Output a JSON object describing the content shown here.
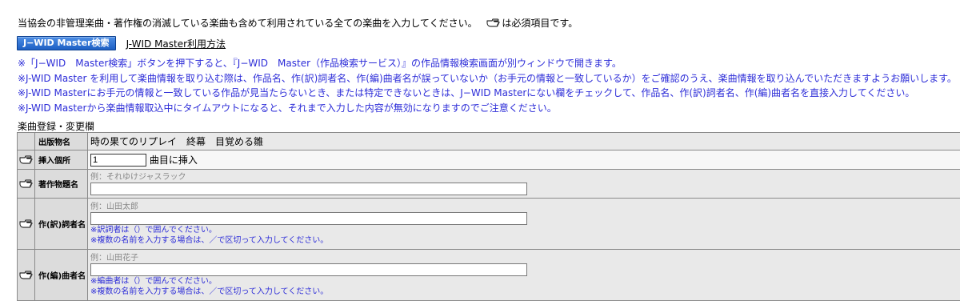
{
  "intro": {
    "text_before": "当協会の非管理楽曲・著作権の消滅している楽曲も含めて利用されている全ての楽曲を入力してください。",
    "required_note": "は必須項目です。",
    "required_icon": "pointing-hand-icon"
  },
  "toolbar": {
    "jwid_button": "J−WID Master検索",
    "jwid_link": "J-WID Master利用方法"
  },
  "notes": [
    "※「J−WID　Master検索」ボタンを押下すると、『J−WID　Master（作品検索サービス）』の作品情報検索画面が別ウィンドウで開きます。",
    "※J-WID Master を利用して楽曲情報を取り込む際は、作品名、作(訳)詞者名、作(編)曲者名が誤っていないか（お手元の情報と一致しているか）をご確認のうえ、楽曲情報を取り込んでいただきますようお願いします。",
    "※J-WID Masterにお手元の情報と一致している作品が見当たらないとき、または特定できないときは、J−WID Masterにない欄をチェックして、作品名、作(訳)詞者名、作(編)曲者名を直接入力してください。",
    "※J-WID Masterから楽曲情報取込中にタイムアウトになると、それまで入力した内容が無効になりますのでご注意ください。"
  ],
  "section_title": "楽曲登録・変更欄",
  "form": {
    "publication": {
      "label": "出版物名",
      "value": "時の果てのリプレイ　終幕　目覚める雛"
    },
    "insert_position": {
      "label": "挿入個所",
      "value": "1",
      "suffix": "曲目に挿入"
    },
    "work_title": {
      "label": "著作物題名",
      "placeholder": "例：それゆけジャスラック",
      "value": ""
    },
    "lyricist": {
      "label": "作(訳)詞者名",
      "placeholder": "例：山田太郎",
      "value": "",
      "notes": [
        "※訳詞者は（）で囲んでください。",
        "※複数の名前を入力する場合は、／で区切って入力してください。"
      ]
    },
    "composer": {
      "label": "作(編)曲者名",
      "placeholder": "例：山田花子",
      "value": "",
      "notes": [
        "※編曲者は（）で囲んでください。",
        "※複数の名前を入力する場合は、／で区切って入力してください。"
      ]
    }
  },
  "colors": {
    "note_blue": "#2d2dd8",
    "button_blue": "#1d5fc4",
    "label_bg": "#dcdcdc",
    "value_bg": "#e9e9e9"
  }
}
